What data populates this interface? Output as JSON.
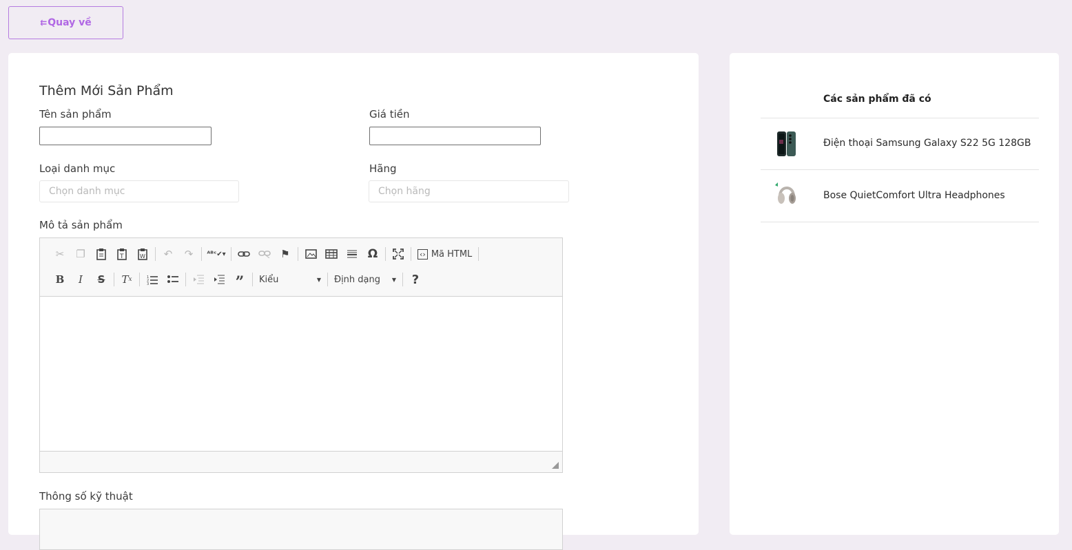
{
  "back_button": {
    "label": "Quay về",
    "icon": "arrow-left-icon"
  },
  "form": {
    "title": "Thêm Mới Sản Phẩm",
    "product_name_label": "Tên sản phẩm",
    "price_label": "Giá tiền",
    "category_label": "Loại danh mục",
    "category_placeholder": "Chọn danh mục",
    "brand_label": "Hãng",
    "brand_placeholder": "Chọn hãng",
    "description_label": "Mô tả sản phẩm",
    "specs_label": "Thông số kỹ thuật"
  },
  "editor": {
    "source_label": "Mã HTML",
    "style_label": "Kiểu",
    "format_label": "Định dạng",
    "help_label": "?"
  },
  "side": {
    "title": "Các sản phẩm đã có",
    "products": [
      {
        "name": "Điện thoại Samsung Galaxy S22 5G 128GB"
      },
      {
        "name": "Bose QuietComfort Ultra Headphones"
      }
    ]
  },
  "colors": {
    "accent": "#b067e4",
    "background": "#f1ecf3"
  }
}
